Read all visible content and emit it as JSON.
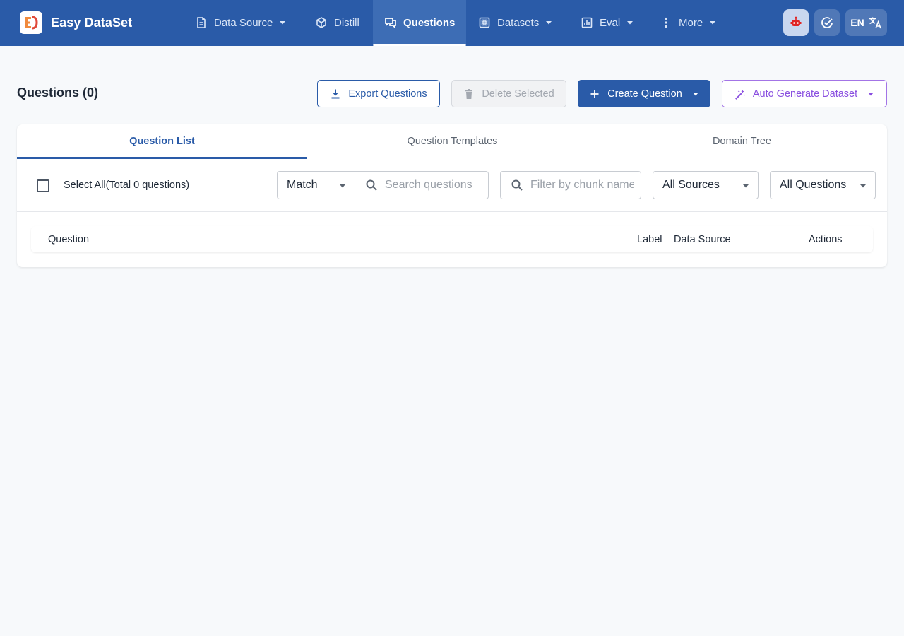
{
  "app": {
    "name": "Easy DataSet",
    "accent": "#2a5ba8"
  },
  "nav": {
    "items": [
      {
        "label": "Data Source",
        "icon": "document-icon",
        "has_dropdown": true
      },
      {
        "label": "Distill",
        "icon": "cube-icon",
        "has_dropdown": false
      },
      {
        "label": "Questions",
        "icon": "chat-icon",
        "has_dropdown": false,
        "active": true
      },
      {
        "label": "Datasets",
        "icon": "grid-icon",
        "has_dropdown": true
      },
      {
        "label": "Eval",
        "icon": "bar-chart-icon",
        "has_dropdown": true
      },
      {
        "label": "More",
        "icon": "more-vertical-icon",
        "has_dropdown": true
      }
    ],
    "right": {
      "robot_icon": "robot-icon",
      "tasks_icon": "check-circle-icon",
      "language": "EN",
      "translate_icon": "translate-icon"
    }
  },
  "header": {
    "title": "Questions (0)",
    "export_label": "Export Questions",
    "delete_label": "Delete Selected",
    "create_label": "Create Question",
    "auto_generate_label": "Auto Generate Dataset"
  },
  "tabs": [
    {
      "label": "Question List",
      "active": true
    },
    {
      "label": "Question Templates",
      "active": false
    },
    {
      "label": "Domain Tree",
      "active": false
    }
  ],
  "filters": {
    "select_all_label": "Select All(Total 0 questions)",
    "match_value": "Match",
    "search_placeholder": "Search questions",
    "chunk_placeholder": "Filter by chunk name",
    "source_value": "All Sources",
    "status_value": "All Questions"
  },
  "table": {
    "columns": [
      "Question",
      "Label",
      "Data Source",
      "Actions"
    ]
  }
}
